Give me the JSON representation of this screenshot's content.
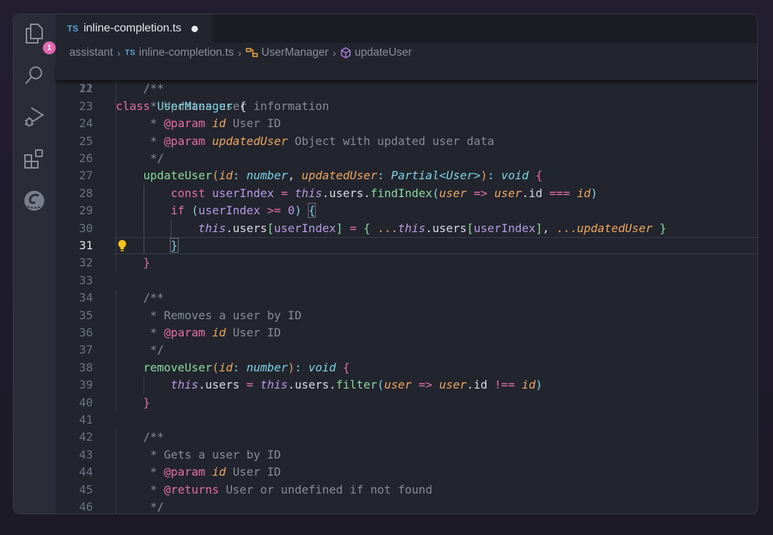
{
  "activity_bar": {
    "items": [
      {
        "name": "explorer",
        "icon": "files-icon",
        "badge": "1"
      },
      {
        "name": "search",
        "icon": "search-icon"
      },
      {
        "name": "run-debug",
        "icon": "run-debug-icon"
      },
      {
        "name": "extensions",
        "icon": "extensions-icon"
      },
      {
        "name": "assistant",
        "icon": "assistant-logo-icon"
      }
    ]
  },
  "tab": {
    "lang": "TS",
    "filename": "inline-completion.ts",
    "modified": true
  },
  "breadcrumb": {
    "folder": "assistant",
    "lang": "TS",
    "file": "inline-completion.ts",
    "class": "UserManager",
    "method": "updateUser"
  },
  "editor": {
    "current_line": 31,
    "sticky": {
      "n": 11,
      "indent": 0,
      "tokens": [
        [
          "class",
          "kw"
        ],
        [
          " ",
          "pl"
        ],
        [
          "UserManager",
          "ty"
        ],
        [
          " ",
          "pl"
        ],
        [
          "{",
          "pl"
        ]
      ]
    },
    "lines": [
      {
        "n": 22,
        "indent": 1,
        "tokens": [
          [
            "/**",
            "cm"
          ]
        ]
      },
      {
        "n": 23,
        "indent": 1,
        "tokens": [
          [
            " * Updates user information",
            "cm"
          ]
        ]
      },
      {
        "n": 24,
        "indent": 1,
        "tokens": [
          [
            " * ",
            "cm"
          ],
          [
            "@param",
            "tag"
          ],
          [
            " ",
            "cm"
          ],
          [
            "id",
            "pa"
          ],
          [
            " User ID",
            "cm"
          ]
        ]
      },
      {
        "n": 25,
        "indent": 1,
        "tokens": [
          [
            " * ",
            "cm"
          ],
          [
            "@param",
            "tag"
          ],
          [
            " ",
            "cm"
          ],
          [
            "updatedUser",
            "pa"
          ],
          [
            " Object with updated user data",
            "cm"
          ]
        ]
      },
      {
        "n": 26,
        "indent": 1,
        "tokens": [
          [
            " */",
            "cm"
          ]
        ]
      },
      {
        "n": 27,
        "indent": 1,
        "tokens": [
          [
            "updateUser",
            "fn"
          ],
          [
            "(",
            "p1"
          ],
          [
            "id",
            "pa"
          ],
          [
            ":",
            "p3"
          ],
          [
            " ",
            "pl"
          ],
          [
            "number",
            "tyi"
          ],
          [
            ",",
            "pl"
          ],
          [
            " ",
            "pl"
          ],
          [
            "updatedUser",
            "pa"
          ],
          [
            ":",
            "p3"
          ],
          [
            " ",
            "pl"
          ],
          [
            "Partial<User>",
            "tyi"
          ],
          [
            ")",
            "p1"
          ],
          [
            ":",
            "p3"
          ],
          [
            " ",
            "pl"
          ],
          [
            "void",
            "tyi"
          ],
          [
            " ",
            "pl"
          ],
          [
            "{",
            "p2"
          ]
        ]
      },
      {
        "n": 28,
        "indent": 2,
        "tokens": [
          [
            "const",
            "kw"
          ],
          [
            " ",
            "pl"
          ],
          [
            "userIndex",
            "va"
          ],
          [
            " ",
            "pl"
          ],
          [
            "=",
            "op"
          ],
          [
            " ",
            "pl"
          ],
          [
            "this",
            "th"
          ],
          [
            ".users.",
            "pl"
          ],
          [
            "findIndex",
            "fn"
          ],
          [
            "(",
            "p3"
          ],
          [
            "user",
            "pa"
          ],
          [
            " ",
            "pl"
          ],
          [
            "=>",
            "op"
          ],
          [
            " ",
            "pl"
          ],
          [
            "user",
            "pa"
          ],
          [
            ".id ",
            "pl"
          ],
          [
            "===",
            "op"
          ],
          [
            " ",
            "pl"
          ],
          [
            "id",
            "pa"
          ],
          [
            ")",
            "p3"
          ]
        ]
      },
      {
        "n": 29,
        "indent": 2,
        "tokens": [
          [
            "if",
            "kw"
          ],
          [
            " ",
            "pl"
          ],
          [
            "(",
            "p3"
          ],
          [
            "userIndex",
            "va"
          ],
          [
            " ",
            "pl"
          ],
          [
            ">=",
            "op"
          ],
          [
            " ",
            "pl"
          ],
          [
            "0",
            "nu"
          ],
          [
            ")",
            "p3"
          ],
          [
            " ",
            "pl"
          ],
          [
            "{",
            "p3"
          ]
        ]
      },
      {
        "n": 30,
        "indent": 3,
        "tokens": [
          [
            "this",
            "th"
          ],
          [
            ".users",
            "pl"
          ],
          [
            "[",
            "br"
          ],
          [
            "userIndex",
            "va"
          ],
          [
            "]",
            "br"
          ],
          [
            " ",
            "pl"
          ],
          [
            "=",
            "op"
          ],
          [
            " ",
            "pl"
          ],
          [
            "{",
            "br"
          ],
          [
            " ",
            "pl"
          ],
          [
            "...",
            "p1"
          ],
          [
            "this",
            "th"
          ],
          [
            ".users",
            "pl"
          ],
          [
            "[",
            "br"
          ],
          [
            "userIndex",
            "va"
          ],
          [
            "]",
            "br"
          ],
          [
            ", ",
            "pl"
          ],
          [
            "...",
            "p1"
          ],
          [
            "updatedUser",
            "pa"
          ],
          [
            " ",
            "pl"
          ],
          [
            "}",
            "br"
          ]
        ]
      },
      {
        "n": 31,
        "indent": 2,
        "tokens": [
          [
            "}",
            "p3"
          ]
        ]
      },
      {
        "n": 32,
        "indent": 1,
        "tokens": [
          [
            "}",
            "p2"
          ]
        ]
      },
      {
        "n": 33,
        "indent": 0,
        "tokens": []
      },
      {
        "n": 34,
        "indent": 1,
        "tokens": [
          [
            "/**",
            "cm"
          ]
        ]
      },
      {
        "n": 35,
        "indent": 1,
        "tokens": [
          [
            " * Removes a user by ID",
            "cm"
          ]
        ]
      },
      {
        "n": 36,
        "indent": 1,
        "tokens": [
          [
            " * ",
            "cm"
          ],
          [
            "@param",
            "tag"
          ],
          [
            " ",
            "cm"
          ],
          [
            "id",
            "pa"
          ],
          [
            " User ID",
            "cm"
          ]
        ]
      },
      {
        "n": 37,
        "indent": 1,
        "tokens": [
          [
            " */",
            "cm"
          ]
        ]
      },
      {
        "n": 38,
        "indent": 1,
        "tokens": [
          [
            "removeUser",
            "fn"
          ],
          [
            "(",
            "p1"
          ],
          [
            "id",
            "pa"
          ],
          [
            ":",
            "p3"
          ],
          [
            " ",
            "pl"
          ],
          [
            "number",
            "tyi"
          ],
          [
            ")",
            "p1"
          ],
          [
            ":",
            "p3"
          ],
          [
            " ",
            "pl"
          ],
          [
            "void",
            "tyi"
          ],
          [
            " ",
            "pl"
          ],
          [
            "{",
            "p2"
          ]
        ]
      },
      {
        "n": 39,
        "indent": 2,
        "tokens": [
          [
            "this",
            "th"
          ],
          [
            ".users ",
            "pl"
          ],
          [
            "=",
            "op"
          ],
          [
            " ",
            "pl"
          ],
          [
            "this",
            "th"
          ],
          [
            ".users.",
            "pl"
          ],
          [
            "filter",
            "fn"
          ],
          [
            "(",
            "p3"
          ],
          [
            "user",
            "pa"
          ],
          [
            " ",
            "pl"
          ],
          [
            "=>",
            "op"
          ],
          [
            " ",
            "pl"
          ],
          [
            "user",
            "pa"
          ],
          [
            ".id ",
            "pl"
          ],
          [
            "!==",
            "op"
          ],
          [
            " ",
            "pl"
          ],
          [
            "id",
            "pa"
          ],
          [
            ")",
            "p3"
          ]
        ]
      },
      {
        "n": 40,
        "indent": 1,
        "tokens": [
          [
            "}",
            "p2"
          ]
        ]
      },
      {
        "n": 41,
        "indent": 0,
        "tokens": []
      },
      {
        "n": 42,
        "indent": 1,
        "tokens": [
          [
            "/**",
            "cm"
          ]
        ]
      },
      {
        "n": 43,
        "indent": 1,
        "tokens": [
          [
            " * Gets a user by ID",
            "cm"
          ]
        ]
      },
      {
        "n": 44,
        "indent": 1,
        "tokens": [
          [
            " * ",
            "cm"
          ],
          [
            "@param",
            "tag"
          ],
          [
            " ",
            "cm"
          ],
          [
            "id",
            "pa"
          ],
          [
            " User ID",
            "cm"
          ]
        ]
      },
      {
        "n": 45,
        "indent": 1,
        "tokens": [
          [
            " * ",
            "cm"
          ],
          [
            "@returns",
            "tag"
          ],
          [
            " User or undefined if not found",
            "cm"
          ]
        ]
      },
      {
        "n": 46,
        "indent": 1,
        "tokens": [
          [
            " */",
            "cm"
          ]
        ]
      }
    ]
  }
}
